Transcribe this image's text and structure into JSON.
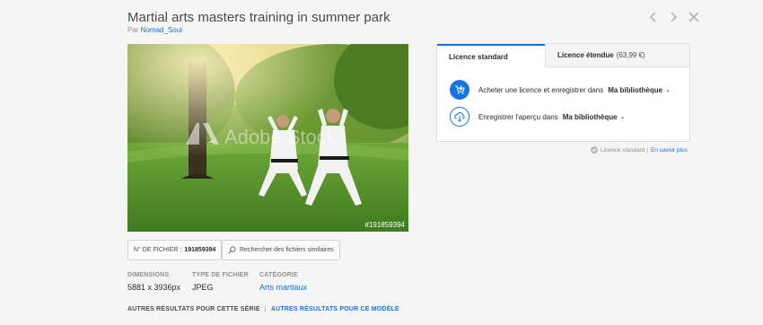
{
  "header": {
    "title": "Martial arts masters training in summer park",
    "by_prefix": "Par",
    "author": "Nomad_Soul"
  },
  "nav": {
    "prev_icon": "chevron-left-icon",
    "next_icon": "chevron-right-icon",
    "close_icon": "close-icon"
  },
  "photo": {
    "watermark": "Adobe Stock",
    "id_overlay": "#191859394"
  },
  "file_chip": {
    "label": "N° DE FICHIER :",
    "value": "191859394"
  },
  "similar_chip": {
    "label": "Rechercher des fichiers similaires"
  },
  "meta": {
    "dimensions": {
      "label": "DIMENSIONS",
      "value": "5881 x 3936px"
    },
    "filetype": {
      "label": "TYPE DE FICHIER",
      "value": "JPEG"
    },
    "category": {
      "label": "CATÉGORIE",
      "value": "Arts martiaux"
    }
  },
  "more_links": {
    "series": "AUTRES RÉSULTATS POUR CETTE SÉRIE",
    "separator": "|",
    "model": "AUTRES RÉSULTATS POUR CE MODÈLE"
  },
  "licence": {
    "tab_standard": "Licence standard",
    "tab_extended": "Licence étendue",
    "tab_extended_price": "(63,99 €)",
    "action_buy": "Acheter une licence et enregistrer dans",
    "action_save": "Enregistrer l'aperçu dans",
    "library": "Ma bibliothèque",
    "accent_color": "#1473e6"
  },
  "licence_note": {
    "text": "Licence standard |",
    "link": "En savoir plus"
  }
}
